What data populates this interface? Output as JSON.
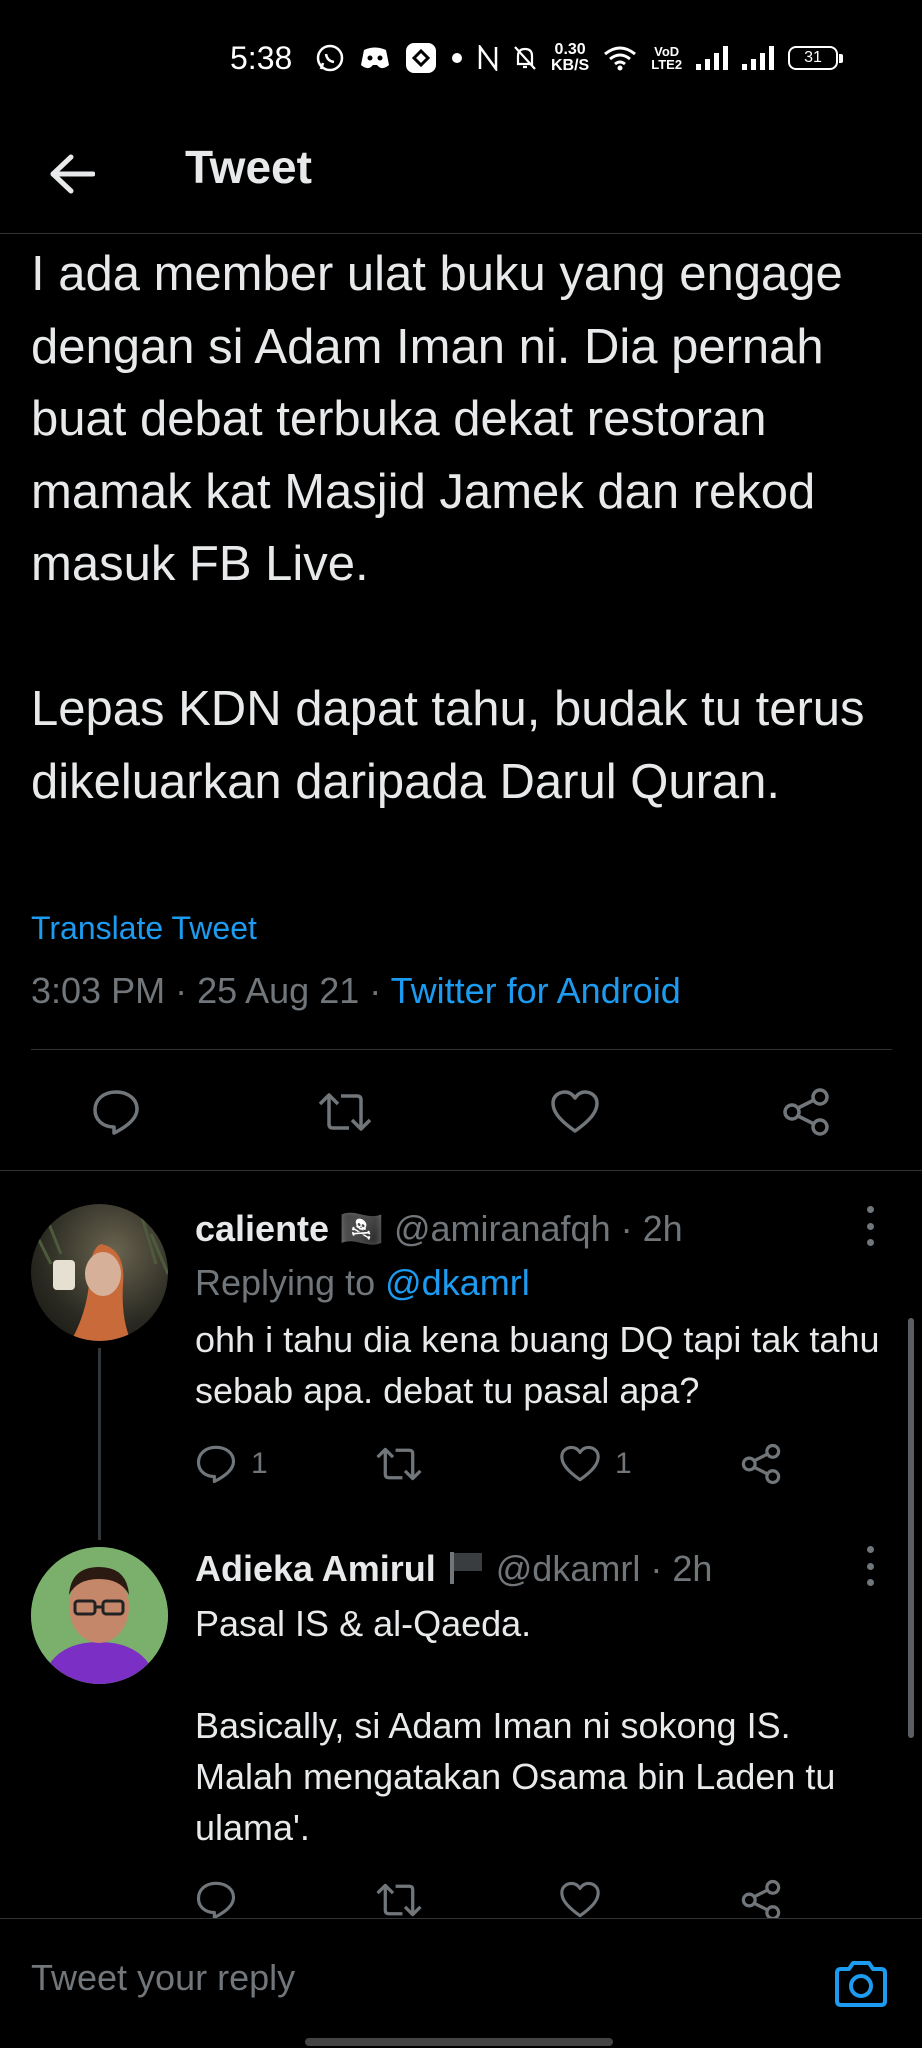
{
  "status_bar": {
    "time": "5:38",
    "net_speed_value": "0.30",
    "net_speed_unit": "KB/S",
    "lte_top": "VoD",
    "lte_bottom": "LTE2",
    "battery": "31"
  },
  "header": {
    "title": "Tweet"
  },
  "tweet": {
    "text": "I ada member ulat buku yang engage dengan si Adam Iman ni. Dia pernah buat debat terbuka dekat restoran mamak kat Masjid Jamek dan rekod masuk FB Live.\n\nLepas KDN dapat tahu, budak tu terus dikeluarkan daripada Darul Quran.",
    "translate_label": "Translate Tweet",
    "time": "3:03 PM",
    "date": "25 Aug 21",
    "source": "Twitter for Android"
  },
  "replies": [
    {
      "name": "caliente",
      "emoji": "🏴‍☠️",
      "handle": "@amiranafqh",
      "age": "2h",
      "replying_prefix": "Replying to",
      "replying_to": "@dkamrl",
      "text": "ohh i tahu dia kena buang DQ tapi tak tahu sebab apa. debat tu pasal apa?",
      "reply_count": "1",
      "like_count": "1"
    },
    {
      "name": "Adieka Amirul",
      "handle": "@dkamrl",
      "age": "2h",
      "text": "Pasal IS & al-Qaeda.\n\nBasically, si Adam Iman ni sokong IS. Malah mengatakan Osama bin Laden tu ulama'.",
      "reply_count": "",
      "like_count": ""
    }
  ],
  "composer": {
    "placeholder": "Tweet your reply"
  },
  "colors": {
    "accent": "#1d9bf0",
    "muted": "#71767b",
    "background": "#000000",
    "text": "#e7e9ea"
  },
  "icons": [
    "back-arrow-icon",
    "reply-icon",
    "retweet-icon",
    "like-icon",
    "share-icon",
    "more-icon",
    "camera-icon"
  ]
}
